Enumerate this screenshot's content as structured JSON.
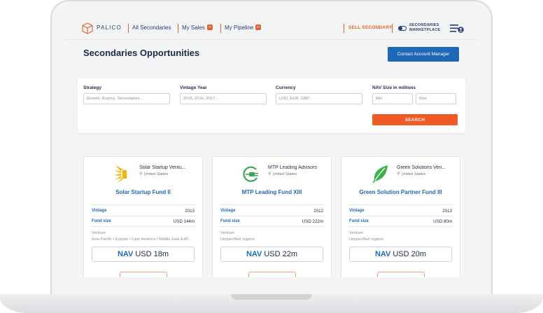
{
  "header": {
    "logo_text": "PALICO",
    "nav": [
      {
        "label": "All Secondaries",
        "badge": false
      },
      {
        "label": "My Sales",
        "badge": true
      },
      {
        "label": "My Pipeline",
        "badge": true
      }
    ],
    "sell_label": "SELL SECONDARY",
    "marketplace_line1": "SECONDARIES",
    "marketplace_line2": "MARKETPLACE"
  },
  "page": {
    "title": "Secondaries Opportunities",
    "contact_button": "Contact Account Manager"
  },
  "filters": {
    "strategy": {
      "label": "Strategy",
      "placeholder": "Growth, Buyout, Secondaries..."
    },
    "vintage": {
      "label": "Vintage Year",
      "placeholder": "2015, 2016, 2017..."
    },
    "currency": {
      "label": "Currency",
      "placeholder": "USD, EUR, GBP..."
    },
    "nav_size": {
      "label": "NAV Size in millions",
      "min_placeholder": "Min",
      "max_placeholder": "Max"
    },
    "search_button": "SEARCH"
  },
  "labels": {
    "vintage": "Vintage",
    "fund_size": "Fund size",
    "nav_key": "NAV"
  },
  "cards": [
    {
      "company": "Solar Startup Ventu...",
      "location": "United States",
      "fund": "Solar Startup Fund II",
      "vintage": "2013",
      "fund_size": "USD 144m",
      "strategy": "Venture",
      "regions": "Asia Pacific • Europe • Latin America • Middle East & Af...",
      "nav_value": "USD 18m",
      "logo": "sunburst-icon",
      "logo_color": "#f5b400"
    },
    {
      "company": "MTP Leading Advisors",
      "location": "United States",
      "fund": "MTP Leading Fund XIII",
      "vintage": "2012",
      "fund_size": "USD 222m",
      "strategy": "Venture",
      "regions": "Unspecified regions",
      "nav_value": "USD 22m",
      "logo": "plug-icon",
      "logo_color": "#3aa457"
    },
    {
      "company": "Green Solutions Ven...",
      "location": "United States",
      "fund": "Green Solution Partner Fund III",
      "vintage": "2013",
      "fund_size": "USD 80m",
      "strategy": "Venture",
      "regions": "Unspecified regions",
      "nav_value": "USD 20m",
      "logo": "leaf-icon",
      "logo_color": "#3fb14a"
    }
  ],
  "colors": {
    "accent_orange": "#f15a22",
    "primary_blue": "#1f68b7",
    "navy": "#1e2a44"
  }
}
